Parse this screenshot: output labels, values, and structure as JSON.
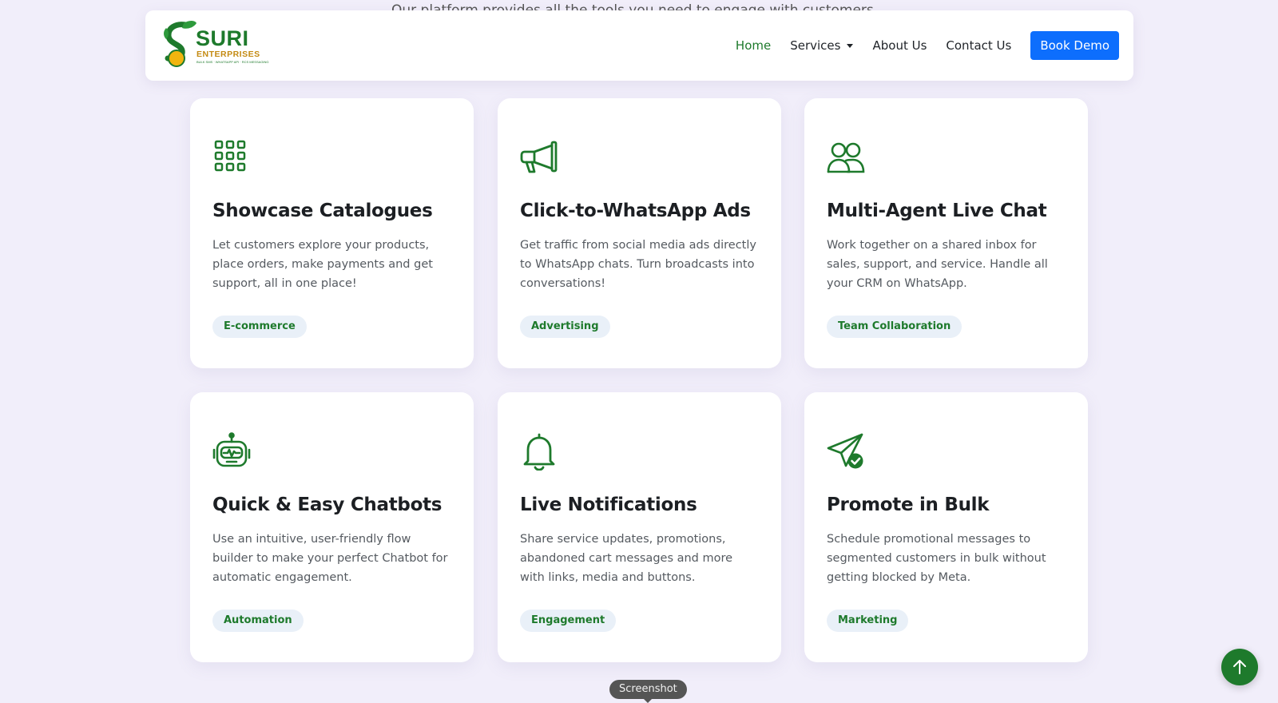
{
  "page": {
    "behind_text": "Our platform provides all the tools you need to engage with customers"
  },
  "nav": {
    "brand": {
      "name": "SURI",
      "subtitle": "ENTERPRISES",
      "tagline": "BULK SMS · WHATSAPP API · RCS MESSAGING"
    },
    "links": [
      {
        "label": "Home",
        "active": true
      },
      {
        "label": "Services",
        "dropdown": true
      },
      {
        "label": "About Us"
      },
      {
        "label": "Contact Us"
      }
    ],
    "cta": "Book Demo"
  },
  "features": [
    {
      "icon": "grid-icon",
      "title": "Showcase Catalogues",
      "description": "Let customers explore your products, place orders, make payments and get support, all in one place!",
      "tag": "E-commerce"
    },
    {
      "icon": "megaphone-icon",
      "title": "Click-to-WhatsApp Ads",
      "description": "Get traffic from social media ads directly to WhatsApp chats. Turn broadcasts into conversations!",
      "tag": "Advertising"
    },
    {
      "icon": "people-icon",
      "title": "Multi-Agent Live Chat",
      "description": "Work together on a shared inbox for sales, support, and service. Handle all your CRM on WhatsApp.",
      "tag": "Team Collaboration"
    },
    {
      "icon": "robot-icon",
      "title": "Quick & Easy Chatbots",
      "description": "Use an intuitive, user-friendly flow builder to make your perfect Chatbot for automatic engagement.",
      "tag": "Automation"
    },
    {
      "icon": "bell-icon",
      "title": "Live Notifications",
      "description": "Share service updates, promotions, abandoned cart messages and more with links, media and buttons.",
      "tag": "Engagement"
    },
    {
      "icon": "send-check-icon",
      "title": "Promote in Bulk",
      "description": "Schedule promotional messages to segmented customers in bulk without getting blocked by Meta.",
      "tag": "Marketing"
    }
  ],
  "tooltip": "Screenshot",
  "colors": {
    "background": "#f1eefa",
    "brand_green": "#1e7a2c",
    "cta_blue": "#0d6efd",
    "badge_bg": "#e9f0f8",
    "brand_gold": "#c48a12"
  },
  "scroll_top_icon": "arrow-up-icon"
}
